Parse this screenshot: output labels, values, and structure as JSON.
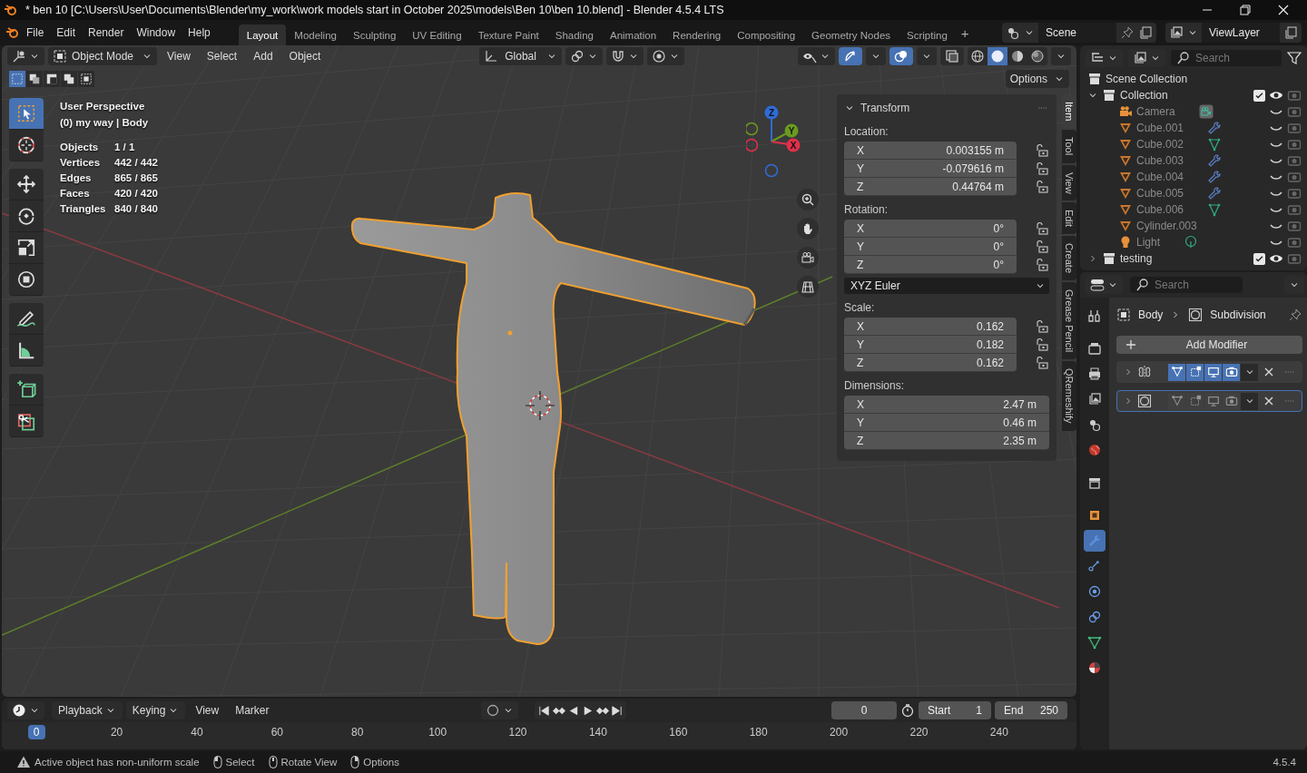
{
  "window": {
    "title": "* ben 10 [C:\\Users\\User\\Documents\\Blender\\my_work\\work models start in October 2025\\models\\Ben 10\\ben 10.blend] - Blender 4.5.4 LTS"
  },
  "menu": [
    "File",
    "Edit",
    "Render",
    "Window",
    "Help"
  ],
  "workspaces": [
    {
      "label": "Layout",
      "selected": true
    },
    {
      "label": "Modeling",
      "selected": false
    },
    {
      "label": "Sculpting",
      "selected": false
    },
    {
      "label": "UV Editing",
      "selected": false
    },
    {
      "label": "Texture Paint",
      "selected": false
    },
    {
      "label": "Shading",
      "selected": false
    },
    {
      "label": "Animation",
      "selected": false
    },
    {
      "label": "Rendering",
      "selected": false
    },
    {
      "label": "Compositing",
      "selected": false
    },
    {
      "label": "Geometry Nodes",
      "selected": false
    },
    {
      "label": "Scripting",
      "selected": false
    }
  ],
  "add_workspace": "+",
  "scene": "Scene",
  "view_layer": "ViewLayer",
  "viewport": {
    "mode": "Object Mode",
    "menus": [
      "View",
      "Select",
      "Add",
      "Object"
    ],
    "orientation": "Global",
    "snap_toggles": [
      {
        "kind": "snap",
        "on": false
      },
      {
        "kind": "proportional",
        "on": false
      }
    ],
    "view_toggles": [
      {
        "kind": "gizmo",
        "on": true
      },
      {
        "kind": "overlays",
        "on": true
      },
      {
        "kind": "xray",
        "on": false
      }
    ],
    "shading": [
      {
        "kind": "wireframe",
        "selected": false
      },
      {
        "kind": "solid",
        "selected": true
      },
      {
        "kind": "material",
        "selected": false
      },
      {
        "kind": "rendered",
        "selected": false
      }
    ],
    "select_modes": [
      {
        "selected": true
      },
      {
        "selected": false
      },
      {
        "selected": false
      },
      {
        "selected": false
      },
      {
        "selected": false
      }
    ],
    "options": "Options",
    "tool_groups": [
      {
        "tools": [
          {
            "kind": "select",
            "selected": true
          },
          {
            "kind": "cursor",
            "selected": false
          }
        ]
      },
      {
        "tools": [
          {
            "kind": "move",
            "selected": false
          },
          {
            "kind": "rotate",
            "selected": false
          },
          {
            "kind": "scale",
            "selected": false
          },
          {
            "kind": "transform",
            "selected": false
          }
        ]
      },
      {
        "tools": [
          {
            "kind": "annotate",
            "selected": false
          },
          {
            "kind": "measure",
            "selected": false
          }
        ]
      },
      {
        "tools": [
          {
            "kind": "add_cube",
            "selected": false
          },
          {
            "kind": "cut",
            "selected": false
          }
        ]
      }
    ],
    "view_name": "User Perspective",
    "context": "(0) my way | Body",
    "stats": [
      {
        "label": "Objects",
        "value": "1 / 1"
      },
      {
        "label": "Vertices",
        "value": "442 / 442"
      },
      {
        "label": "Edges",
        "value": "865 / 865"
      },
      {
        "label": "Faces",
        "value": "420 / 420"
      },
      {
        "label": "Triangles",
        "value": "840 / 840"
      }
    ],
    "gizmo_axes": [
      {
        "label": "Z",
        "color": "#2f6bd8"
      },
      {
        "label": "Y",
        "color": "#6b9a1f"
      },
      {
        "label": "X",
        "color": "#e0304a"
      }
    ],
    "sidebar_tabs": [
      {
        "label": "Item",
        "selected": true
      },
      {
        "label": "Tool",
        "selected": false
      },
      {
        "label": "View",
        "selected": false
      },
      {
        "label": "Edit",
        "selected": false
      },
      {
        "label": "Create",
        "selected": false
      },
      {
        "label": "Grease Pencil",
        "selected": false
      },
      {
        "label": "QRemeshify",
        "selected": false
      }
    ],
    "panel": {
      "title": "Transform",
      "expanded": true,
      "groups": [
        {
          "kind": "vector",
          "label": "Location:",
          "fields": [
            {
              "axis": "X",
              "value": "0.003155 m",
              "locked": false
            },
            {
              "axis": "Y",
              "value": "-0.079616 m",
              "locked": false
            },
            {
              "axis": "Z",
              "value": "0.44764 m",
              "locked": false
            }
          ]
        },
        {
          "kind": "vector",
          "label": "Rotation:",
          "fields": [
            {
              "axis": "X",
              "value": "0°",
              "locked": false
            },
            {
              "axis": "Y",
              "value": "0°",
              "locked": false
            },
            {
              "axis": "Z",
              "value": "0°",
              "locked": false
            }
          ]
        },
        {
          "kind": "dropdown",
          "value": "XYZ Euler"
        },
        {
          "kind": "vector",
          "label": "Scale:",
          "fields": [
            {
              "axis": "X",
              "value": "0.162",
              "locked": false
            },
            {
              "axis": "Y",
              "value": "0.182",
              "locked": false
            },
            {
              "axis": "Z",
              "value": "0.162",
              "locked": false
            }
          ]
        },
        {
          "kind": "vector",
          "label": "Dimensions:",
          "fields": [
            {
              "axis": "X",
              "value": "2.47 m"
            },
            {
              "axis": "Y",
              "value": "0.46 m"
            },
            {
              "axis": "Z",
              "value": "2.35 m"
            }
          ]
        }
      ]
    }
  },
  "outliner": {
    "search_placeholder": "Search",
    "tree": [
      {
        "label": "Scene Collection",
        "kind": "scene_collection",
        "children": [
          {
            "label": "Collection",
            "kind": "collection",
            "expanded": true,
            "checked": true,
            "visible": true,
            "children": [
              {
                "label": "Camera",
                "kind": "camera",
                "badge": {
                  "kind": "camera"
                },
                "visible": false
              },
              {
                "label": "Cube.001",
                "kind": "mesh",
                "badge": {
                  "kind": "modifier"
                },
                "visible": false
              },
              {
                "label": "Cube.002",
                "kind": "mesh",
                "badge": {
                  "kind": "mesh"
                },
                "visible": false
              },
              {
                "label": "Cube.003",
                "kind": "mesh",
                "badge": {
                  "kind": "modifier"
                },
                "visible": false
              },
              {
                "label": "Cube.004",
                "kind": "mesh",
                "badge": {
                  "kind": "modifier"
                },
                "visible": false
              },
              {
                "label": "Cube.005",
                "kind": "mesh",
                "badge": {
                  "kind": "modifier"
                },
                "visible": false
              },
              {
                "label": "Cube.006",
                "kind": "mesh",
                "badge": {
                  "kind": "mesh"
                },
                "visible": false
              },
              {
                "label": "Cylinder.003",
                "kind": "mesh",
                "visible": false
              },
              {
                "label": "Light",
                "kind": "light",
                "badge": {
                  "kind": "light"
                },
                "visible": false
              }
            ]
          },
          {
            "label": "testing",
            "kind": "collection",
            "expanded": false,
            "checked": true,
            "visible": true
          }
        ]
      }
    ]
  },
  "properties": {
    "search_placeholder": "Search",
    "tab_groups": [
      {
        "tabs": [
          {
            "kind": "tool",
            "selected": false
          }
        ]
      },
      {
        "tabs": [
          {
            "kind": "render",
            "selected": false
          },
          {
            "kind": "output",
            "selected": false
          },
          {
            "kind": "view_layer",
            "selected": false
          },
          {
            "kind": "scene",
            "selected": false
          },
          {
            "kind": "world",
            "selected": false
          }
        ]
      },
      {
        "tabs": [
          {
            "kind": "collection",
            "selected": false
          }
        ]
      },
      {
        "tabs": [
          {
            "kind": "object",
            "selected": false
          },
          {
            "kind": "modifiers",
            "selected": true
          },
          {
            "kind": "particles",
            "selected": false
          },
          {
            "kind": "physics",
            "selected": false
          },
          {
            "kind": "constraints",
            "selected": false
          },
          {
            "kind": "data",
            "selected": false
          },
          {
            "kind": "material",
            "selected": false
          }
        ]
      }
    ],
    "breadcrumb": [
      "Body",
      "Subdivision"
    ],
    "add_modifier": "Add Modifier",
    "modifiers": [
      {
        "kind": "mirror",
        "selected": false,
        "toggles": [
          {
            "kind": "edit_mode",
            "on": true
          },
          {
            "kind": "cage",
            "on": true
          },
          {
            "kind": "viewport",
            "on": true
          },
          {
            "kind": "render",
            "on": true
          }
        ]
      },
      {
        "kind": "subdivision",
        "selected": true,
        "toggles": [
          {
            "kind": "edit_mode",
            "on": false
          },
          {
            "kind": "cage",
            "on": false
          },
          {
            "kind": "viewport",
            "on": false
          },
          {
            "kind": "render",
            "on": false
          }
        ]
      }
    ]
  },
  "timeline": {
    "menus": [
      {
        "label": "Playback",
        "dropdown": true
      },
      {
        "label": "Keying",
        "dropdown": true
      },
      {
        "label": "View",
        "dropdown": false
      },
      {
        "label": "Marker",
        "dropdown": false
      }
    ],
    "current_frame": "0",
    "start_label": "Start",
    "start": "1",
    "end_label": "End",
    "end": "250",
    "ruler": [
      {
        "label": "0",
        "selected": true
      },
      {
        "label": "20",
        "selected": false
      },
      {
        "label": "40",
        "selected": false
      },
      {
        "label": "60",
        "selected": false
      },
      {
        "label": "80",
        "selected": false
      },
      {
        "label": "100",
        "selected": false
      },
      {
        "label": "120",
        "selected": false
      },
      {
        "label": "140",
        "selected": false
      },
      {
        "label": "160",
        "selected": false
      },
      {
        "label": "180",
        "selected": false
      },
      {
        "label": "200",
        "selected": false
      },
      {
        "label": "220",
        "selected": false
      },
      {
        "label": "240",
        "selected": false
      }
    ]
  },
  "status_bar": {
    "message": "Active object has non-uniform scale",
    "hints": [
      {
        "kind": "left",
        "label": "Select"
      },
      {
        "kind": "middle",
        "label": "Rotate View"
      },
      {
        "kind": "right",
        "label": "Options"
      }
    ],
    "version": "4.5.4"
  }
}
